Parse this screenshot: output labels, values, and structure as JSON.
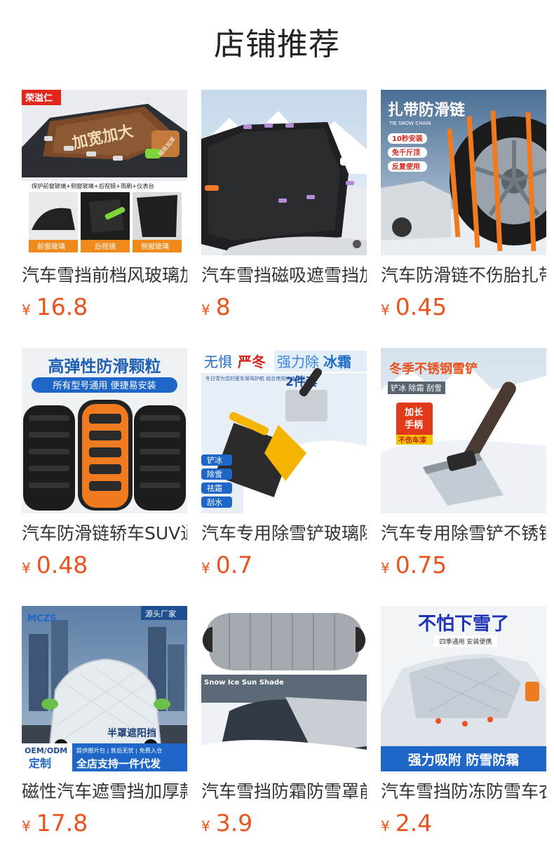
{
  "section": {
    "title": "店铺推荐"
  },
  "currency": "¥",
  "colors": {
    "price": "#e8531f",
    "title": "#222222",
    "name": "#333333"
  },
  "products": [
    {
      "name": "汽车雪挡前档风玻璃加厚",
      "price": "16.8",
      "image": {
        "brand_tag": "荣溢仁",
        "headline": "加宽加大",
        "side_tag": "磁吸加厚",
        "feature_line": "保护前窗玻璃+侧窗玻璃+后视镜+雨刷+仪表台",
        "parts": [
          "前窗玻璃",
          "后视镜",
          "侧窗玻璃"
        ]
      }
    },
    {
      "name": "汽车雪挡磁吸遮雪挡加厚",
      "price": "8",
      "image": {}
    },
    {
      "name": "汽车防滑链不伤胎扎带",
      "price": "0.45",
      "image": {
        "headline": "扎带防滑链",
        "subtitle": "TIE SNOW CHAIN",
        "badges": [
          "10秒安装",
          "免千斤顶",
          "反复使用"
        ]
      }
    },
    {
      "name": "汽车防滑链轿车SUV通用",
      "price": "0.48",
      "image": {
        "headline": "高弹性防滑颗粒",
        "banner": "所有型号通用 便捷易安装"
      }
    },
    {
      "name": "汽车专用除雪铲玻璃除霜",
      "price": "0.7",
      "image": {
        "headline_a": "无惧",
        "headline_b": "严冬",
        "headline_c": "强力除",
        "headline_d": "冰霜",
        "small_text": "冬日雪为您的爱车保驾护航 组合使用快速清理",
        "set_label": "2件套",
        "features": [
          "铲冰",
          "除雪",
          "祛霜",
          "刮水"
        ]
      }
    },
    {
      "name": "汽车专用除雪铲不锈钢",
      "price": "0.75",
      "image": {
        "headline": "冬季不锈钢雪铲",
        "subline": "铲冰 除霜 刮雪",
        "badge_lines": [
          "加长",
          "手柄"
        ],
        "badge_note": "不伤车漆"
      }
    },
    {
      "name": "磁性汽车遮雪挡加厚款",
      "price": "17.8",
      "image": {
        "logo": "MCZS",
        "corner_tag": "源头厂家",
        "caption": "半罩遮阳挡",
        "oem": "OEM/ODM",
        "custom": "定制",
        "service_line": "提供图片包 | 售后无忧 | 免费入仓",
        "slogan": "全店支持一件代发"
      }
    },
    {
      "name": "汽车雪挡防霜防雪罩前挡",
      "price": "3.9",
      "image": {
        "caption": "Snow Ice Sun Shade"
      }
    },
    {
      "name": "汽车雪挡防冻防雪车衣",
      "price": "2.4",
      "image": {
        "headline": "不怕下雪了",
        "subline": "四季通用 安装便携",
        "banner": "强力吸附 防雪防霜"
      }
    }
  ]
}
